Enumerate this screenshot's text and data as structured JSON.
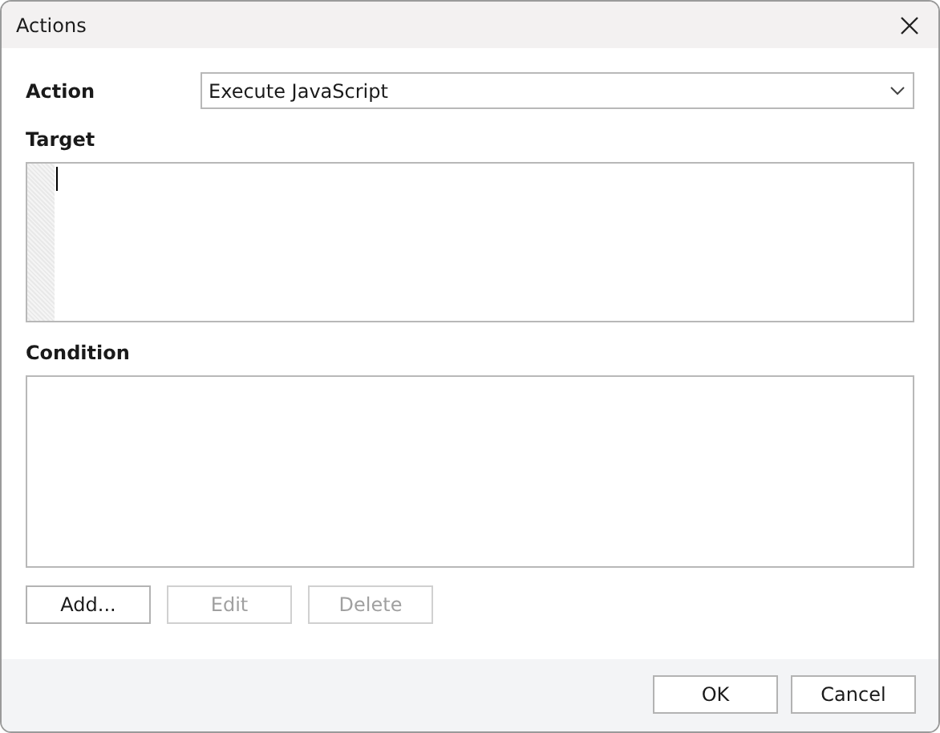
{
  "window": {
    "title": "Actions"
  },
  "action": {
    "label": "Action",
    "value": "Execute JavaScript"
  },
  "target": {
    "label": "Target"
  },
  "condition": {
    "label": "Condition"
  },
  "list_buttons": [
    {
      "label": "Add...",
      "disabled": false
    },
    {
      "label": "Edit",
      "disabled": true
    },
    {
      "label": "Delete",
      "disabled": true
    }
  ],
  "footer_buttons": [
    {
      "label": "OK"
    },
    {
      "label": "Cancel"
    }
  ]
}
